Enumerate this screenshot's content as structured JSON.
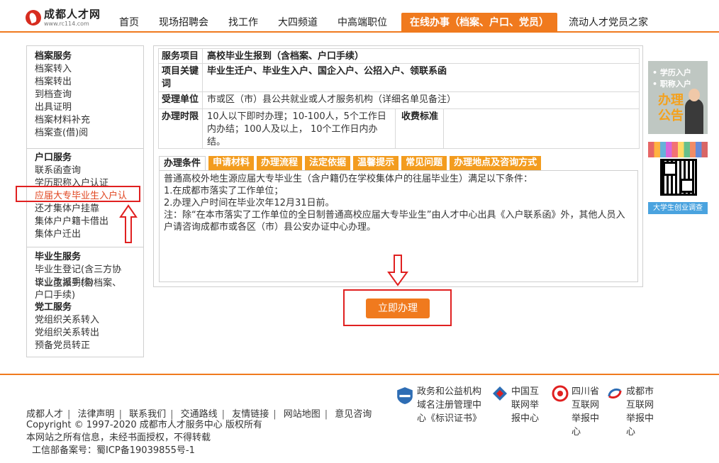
{
  "header": {
    "logo_name": "成都人才网",
    "logo_url": "www.rc114.com",
    "nav": [
      {
        "label": "首页",
        "active": false
      },
      {
        "label": "现场招聘会",
        "active": false
      },
      {
        "label": "找工作",
        "active": false
      },
      {
        "label": "大四频道",
        "active": false
      },
      {
        "label": "中高端职位",
        "active": false
      },
      {
        "label": "在线办事（档案、户口、党员）",
        "active": true
      },
      {
        "label": "流动人才党员之家",
        "active": false
      }
    ]
  },
  "sidebar": {
    "groups": [
      {
        "title": "档案服务",
        "items": [
          "档案转入",
          "档案转出",
          "到档查询",
          "出具证明",
          "档案材料补充",
          "档案查(借)阅"
        ]
      },
      {
        "title": "户口服务",
        "items": [
          "联系函查询",
          "学历职称入户认证",
          "应届大专毕业生入户认",
          "还才集体户挂靠",
          "集体户户籍卡借出",
          "集体户迁出"
        ]
      },
      {
        "title": "毕业生服务",
        "items": [
          "毕业生登记(含三方协",
          "议业改派手续)",
          "毕业生报到(含档案、",
          "户口手续)"
        ]
      },
      {
        "title": "党工服务",
        "items": [
          "党组织关系转入",
          "党组织关系转出",
          "预备党员转正"
        ]
      }
    ]
  },
  "service": {
    "rows": [
      {
        "label": "服务项目",
        "value": "高校毕业生报到（含档案、户口手续）"
      },
      {
        "label": "项目关键词",
        "value": "毕业生迁户、毕业生入户、国企入户、公招入户、领联系函"
      },
      {
        "label": "受理单位",
        "value": "市或区（市）县公共就业或人才服务机构（详细名单见备注）"
      },
      {
        "label": "办理时限",
        "value": "10人以下即时办理；10-100人，5个工作日内办结；100人及以上， 10个工作日内办结。"
      }
    ],
    "fee_label": "收费标准",
    "fee_value": ""
  },
  "tabs": [
    "办理条件",
    "申请材料",
    "办理流程",
    "法定依据",
    "温馨提示",
    "常见问题",
    "办理地点及咨询方式"
  ],
  "tab_content": [
    "普通高校外地生源应届大专毕业生（含户籍仍在学校集体户的往届毕业生）满足以下条件：",
    "1.在成都市落实了工作单位；",
    "2.办理入户时间在毕业次年12月31日前。",
    "注：除“在本市落实了工作单位的全日制普通高校应届大专毕业生”由人才中心出具《入户联系函》外，其他人员入户请咨询成都市或各区（市）县公安办证中心办理。"
  ],
  "action": {
    "label": "立即办理"
  },
  "banners": {
    "ad1_line1": "• 学历入户",
    "ad1_line2": "• 职称入户",
    "ad1_big": "办理公告",
    "ad2_caption": "大学生创业调查"
  },
  "footer": {
    "links": [
      "成都人才",
      "法律声明",
      "联系我们",
      "交通路线",
      "友情链接",
      "网站地图",
      "意见咨询"
    ],
    "copyright": "Copyright © 1997-2020 成都市人才服务中心 版权所有",
    "notice": "本网站之所有信息，未经书面授权，不得转载",
    "icp": "工信部备案号：蜀ICP备19039855号-1",
    "badges": [
      {
        "text": "政务和公益机构域名注册管理中心《标识证书》"
      },
      {
        "text": "中国互联网举报中心"
      },
      {
        "text": "四川省互联网举报中心"
      },
      {
        "text": "成都市互联网举报中心"
      }
    ]
  }
}
